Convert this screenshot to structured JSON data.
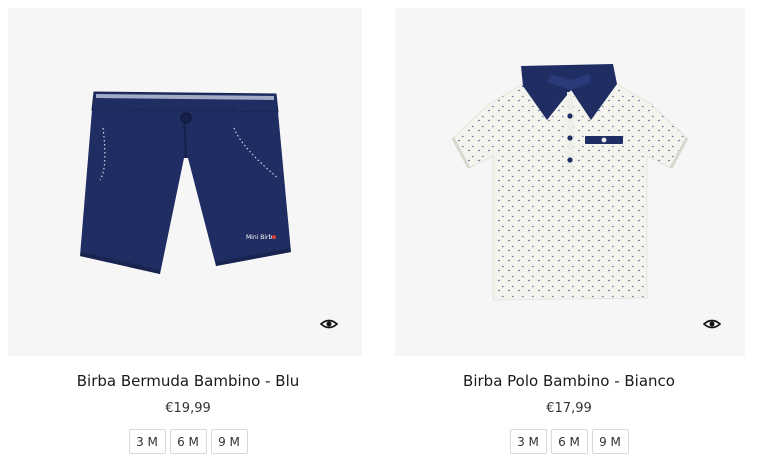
{
  "products": [
    {
      "name": "Birba Bermuda Bambino - Blu",
      "price": "€19,99",
      "garment_color": "#1f2d62",
      "brand_mark": "Mini Birba",
      "quick_view_icon": "eye-icon",
      "sizes": [
        "3 M",
        "6 M",
        "9 M"
      ]
    },
    {
      "name": "Birba Polo Bambino - Bianco",
      "price": "€17,99",
      "garment_color": "#f4f4ef",
      "accent_color": "#1f2d62",
      "quick_view_icon": "eye-icon",
      "sizes": [
        "3 M",
        "6 M",
        "9 M"
      ]
    }
  ]
}
